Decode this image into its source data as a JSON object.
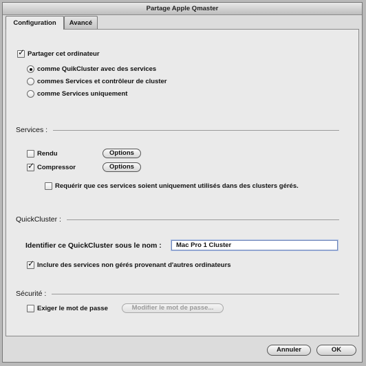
{
  "window": {
    "title": "Partage Apple Qmaster"
  },
  "tabs": [
    {
      "label": "Configuration",
      "active": true
    },
    {
      "label": "Avancé",
      "active": false
    }
  ],
  "sharing": {
    "label": "Partager cet ordinateur",
    "checked": true,
    "options": [
      {
        "label": "comme QuikCluster avec des services",
        "selected": true
      },
      {
        "label": "commes Services et contrôleur de cluster",
        "selected": false
      },
      {
        "label": "comme Services uniquement",
        "selected": false
      }
    ]
  },
  "services": {
    "title": "Services :",
    "rendu": {
      "label": "Rendu",
      "checked": false,
      "button": "Options"
    },
    "compressor": {
      "label": "Compressor",
      "checked": true,
      "button": "Options"
    },
    "managed_only": {
      "label": "Requérir que ces services soient uniquement utilisés dans des clusters gérés.",
      "checked": false
    }
  },
  "quickcluster": {
    "title": "QuickCluster :",
    "name_label": "Identifier ce QuickCluster sous le nom :",
    "name_value": "Mac Pro 1 Cluster",
    "include_unmanaged": {
      "label": "Inclure des services non gérés provenant d'autres ordinateurs",
      "checked": true
    }
  },
  "security": {
    "title": "Sécurité :",
    "require_password": {
      "label": "Exiger le mot de passe",
      "checked": false
    },
    "change_password_button": "Modifier le mot de passe..."
  },
  "footer": {
    "cancel": "Annuler",
    "ok": "OK"
  },
  "check_glyph": "✓"
}
